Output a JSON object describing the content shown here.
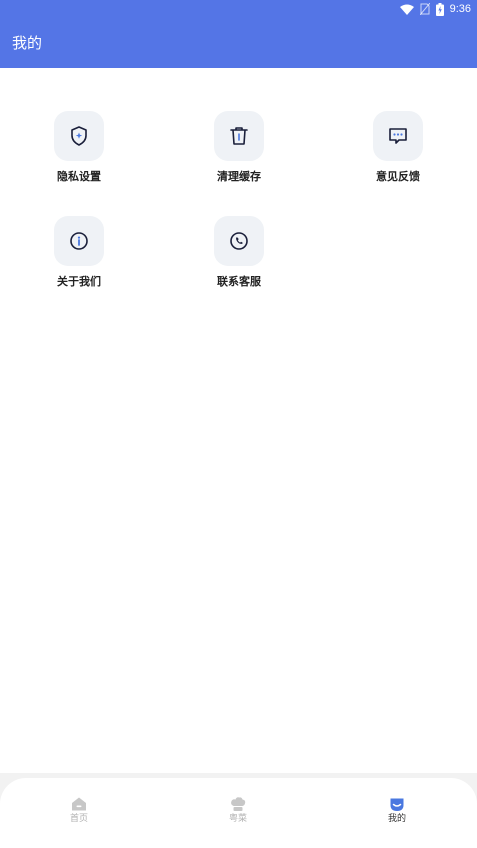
{
  "status_bar": {
    "time": "9:36",
    "icons": [
      "wifi-icon",
      "no-sim-icon",
      "battery-icon"
    ]
  },
  "header": {
    "title": "我的"
  },
  "menu": {
    "items": [
      {
        "label": "隐私设置",
        "icon": "shield-icon"
      },
      {
        "label": "清理缓存",
        "icon": "trash-icon"
      },
      {
        "label": "意见反馈",
        "icon": "chat-icon"
      },
      {
        "label": "关于我们",
        "icon": "info-icon"
      },
      {
        "label": "联系客服",
        "icon": "phone-icon"
      }
    ]
  },
  "bottom_nav": {
    "items": [
      {
        "label": "首页",
        "icon": "home-icon",
        "active": false
      },
      {
        "label": "粤菜",
        "icon": "chef-hat-icon",
        "active": false
      },
      {
        "label": "我的",
        "icon": "profile-icon",
        "active": true
      }
    ]
  },
  "colors": {
    "brand": "#5475e6",
    "icon_bg": "#eff2f6",
    "icon_stroke": "#1a1f3a",
    "icon_accent": "#4a78e0",
    "nav_inactive": "#b0b0b0",
    "nav_active": "#333333"
  }
}
